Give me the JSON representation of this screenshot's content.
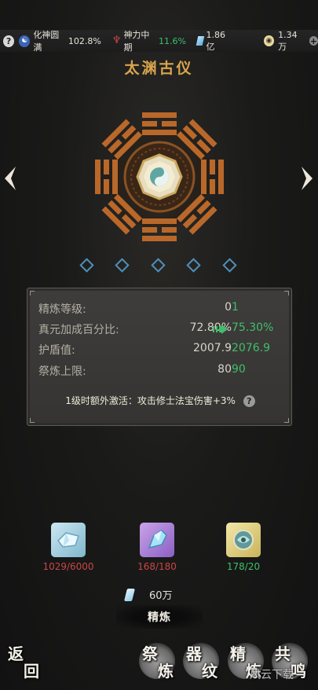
{
  "topbar": {
    "help": "?",
    "realm_label": "化神圆满",
    "realm_value": "102.8%",
    "power_label": "神力中期",
    "power_value": "11.6%",
    "gems": "1.86亿",
    "coins": "1.34万",
    "plus": "+"
  },
  "title": "太渊古仪",
  "carousel": {
    "dot_count": 5
  },
  "stats": {
    "rows": [
      {
        "label": "精炼等级:",
        "current": "0",
        "next": "1"
      },
      {
        "label": "真元加成百分比:",
        "current": "72.80%",
        "next": "75.30%"
      },
      {
        "label": "护盾值:",
        "current": "2007.9",
        "next": "2076.9"
      },
      {
        "label": "祭炼上限:",
        "current": "80",
        "next": "90"
      }
    ],
    "extra": "1级时额外激活：攻击修士法宝伤害+3%",
    "help": "?"
  },
  "materials": [
    {
      "count": "1029/6000",
      "status": "insufficient"
    },
    {
      "count": "168/180",
      "status": "insufficient"
    },
    {
      "count": "178/20",
      "status": "sufficient"
    }
  ],
  "cost": {
    "amount": "60万"
  },
  "refine_button": "精炼",
  "bottom": {
    "back": [
      "返",
      "回"
    ],
    "jilian": [
      "祭",
      "炼"
    ],
    "qiwen": [
      "器",
      "纹"
    ],
    "jinglian": [
      "精",
      "炼"
    ],
    "gongming": [
      "共",
      "鸣"
    ]
  },
  "watermark": "风云下载",
  "colors": {
    "title_gold": "#d9a54c",
    "trigram_orange": "#b9682a",
    "positive_green": "#3fbf6a",
    "insufficient_red": "#c84646",
    "diamond_blue": "#4f8fb8"
  }
}
